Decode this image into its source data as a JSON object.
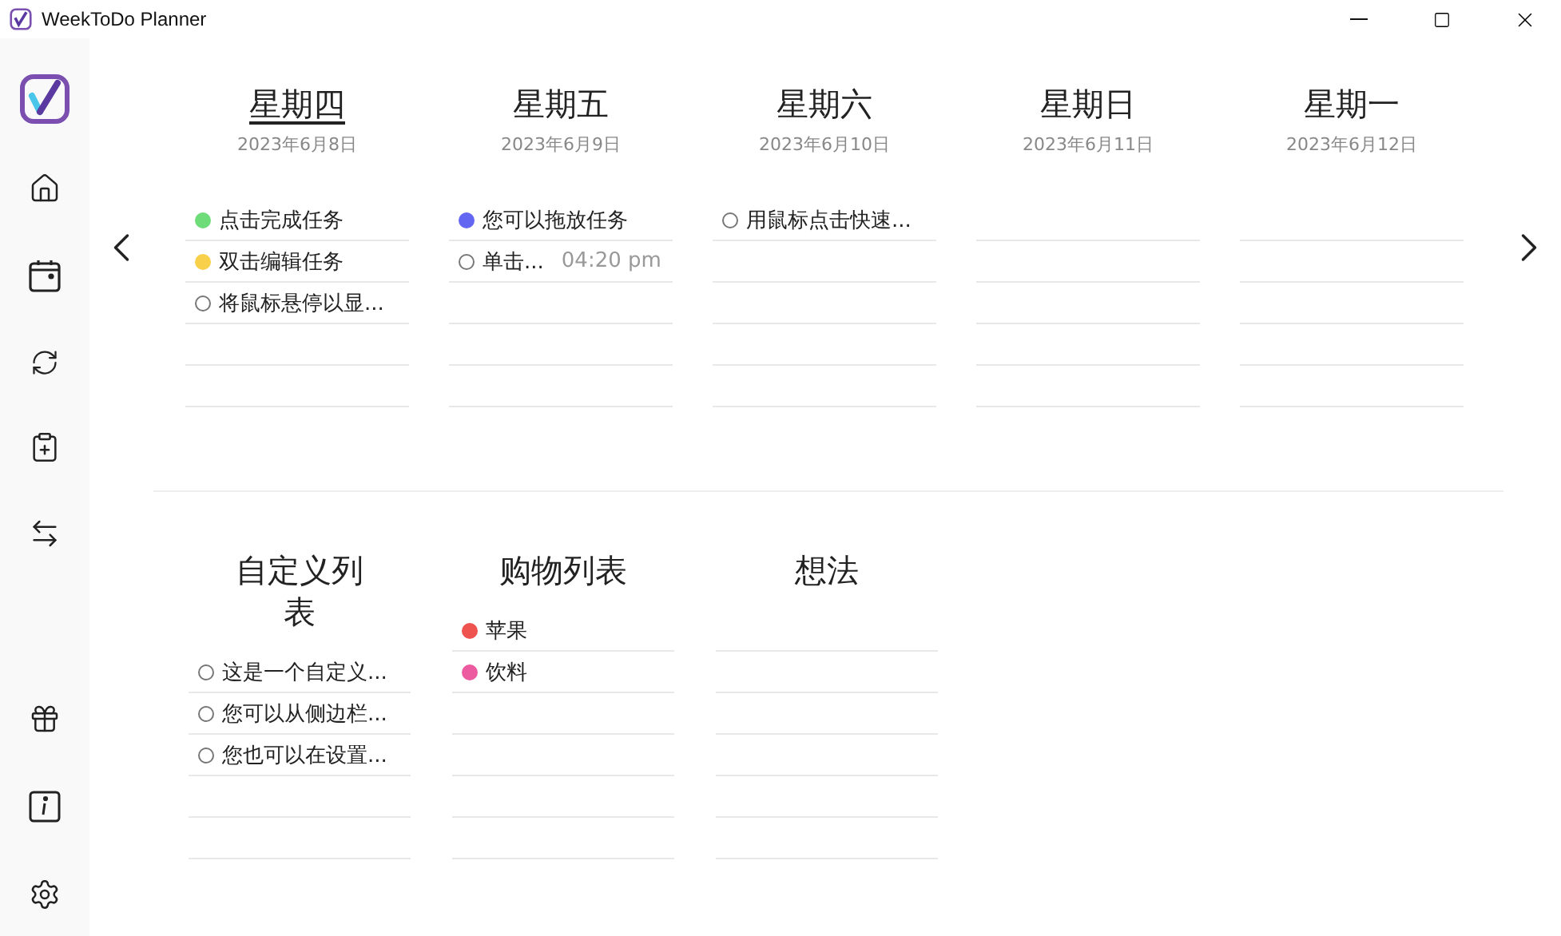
{
  "window": {
    "title": "WeekToDo Planner"
  },
  "days": [
    {
      "name": "星期四",
      "date": "2023年6月8日",
      "today": true,
      "tasks": [
        {
          "text": "点击完成任务",
          "color": "#6fdc7a"
        },
        {
          "text": "双击编辑任务",
          "color": "#f9d04a"
        },
        {
          "text": "将鼠标悬停以显..."
        }
      ]
    },
    {
      "name": "星期五",
      "date": "2023年6月9日",
      "today": false,
      "tasks": [
        {
          "text": "您可以拖放任务",
          "color": "#6366f1"
        },
        {
          "text": "单击...",
          "time": "04:20 pm"
        }
      ]
    },
    {
      "name": "星期六",
      "date": "2023年6月10日",
      "today": false,
      "tasks": [
        {
          "text": "用鼠标点击快速..."
        }
      ]
    },
    {
      "name": "星期日",
      "date": "2023年6月11日",
      "today": false
    },
    {
      "name": "星期一",
      "date": "2023年6月12日",
      "today": false
    }
  ],
  "custom_lists": [
    {
      "name": "自定义列表",
      "tasks": [
        {
          "text": "这是一个自定义..."
        },
        {
          "text": "您可以从侧边栏..."
        },
        {
          "text": "您也可以在设置..."
        }
      ]
    },
    {
      "name": "购物列表",
      "tasks": [
        {
          "text": "苹果",
          "color": "#ef5350"
        },
        {
          "text": "饮料",
          "color": "#ec5aa0"
        }
      ]
    },
    {
      "name": "想法"
    }
  ]
}
